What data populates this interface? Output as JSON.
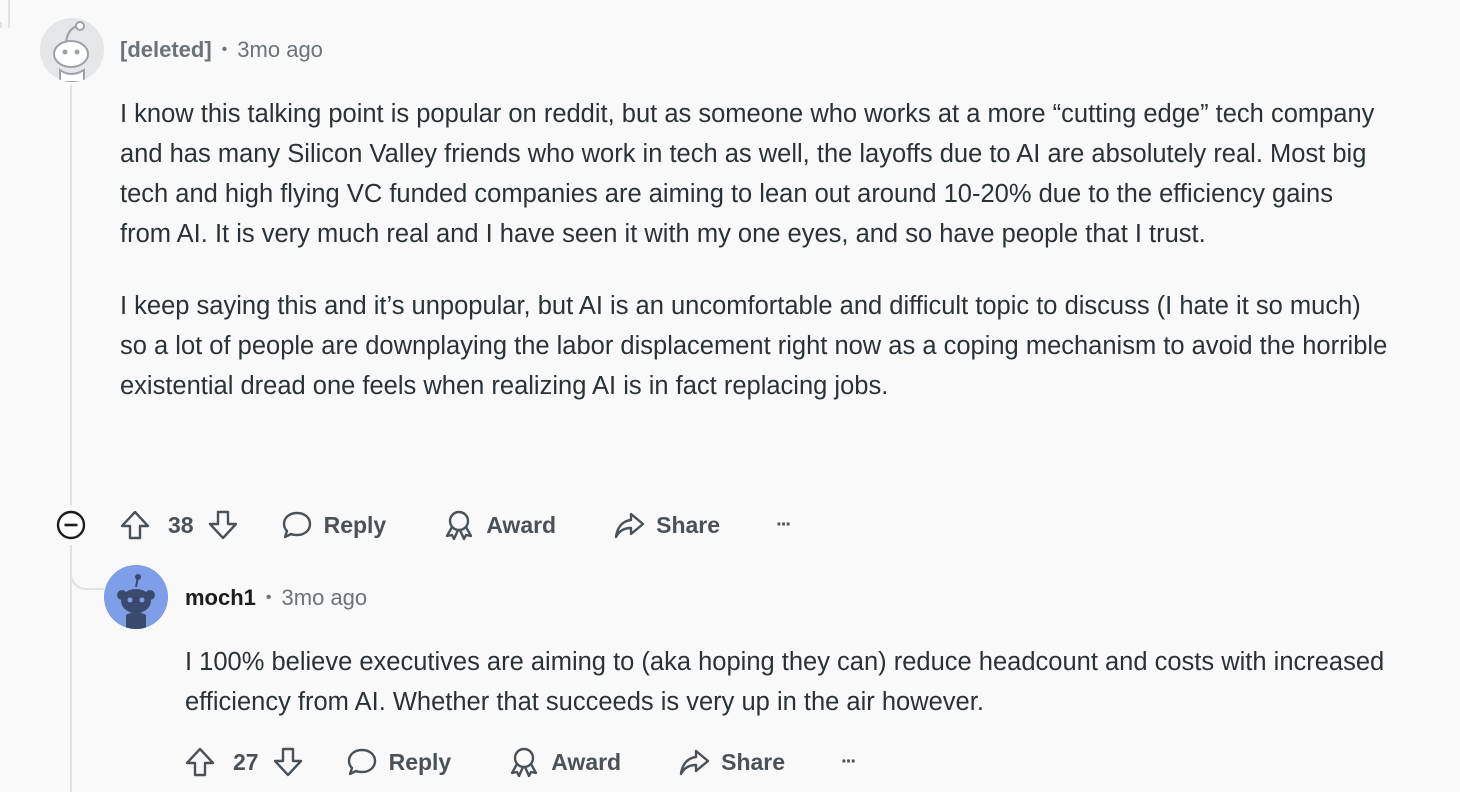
{
  "comments": [
    {
      "author": "[deleted]",
      "separator": "•",
      "time": "3mo ago",
      "paragraphs": [
        "I know this talking point is popular on reddit, but as someone who works at a more “cutting edge” tech company and has many Silicon Valley friends who work in tech as well, the layoffs due to AI are absolutely real. Most big tech and high flying VC funded companies are aiming to lean out around 10-20% due to the efficiency gains from AI. It is very much real and I have seen it with my one eyes, and so have people that I trust.",
        "I keep saying this and it’s unpopular, but AI is an uncomfortable and difficult topic to discuss (I hate it so much) so a lot of people are downplaying the labor displacement right now as a coping mechanism to avoid the horrible existential dread one feels when realizing AI is in fact replacing jobs."
      ],
      "score": "38",
      "reply_label": "Reply",
      "award_label": "Award",
      "share_label": "Share",
      "more_label": "···"
    },
    {
      "author": "moch1",
      "separator": "•",
      "time": "3mo ago",
      "paragraphs": [
        "I 100% believe executives are aiming to (aka hoping they can) reduce headcount and costs with increased efficiency from AI. Whether that succeeds is very up in the air however."
      ],
      "score": "27",
      "reply_label": "Reply",
      "award_label": "Award",
      "share_label": "Share",
      "more_label": "···"
    }
  ],
  "icons": {
    "upvote": "arrow-up-outline",
    "downvote": "arrow-down-outline",
    "reply": "speech-bubble",
    "award": "award-ribbon",
    "share": "share-arrow",
    "collapse": "minus-circle"
  },
  "colors": {
    "background": "#f9f9fa",
    "meta_text": "#6b7379",
    "body_text": "#2a3236",
    "action_text": "#4b5257",
    "thread_line": "#dfe1e3",
    "avatar_blue": "#7e9ee8"
  }
}
